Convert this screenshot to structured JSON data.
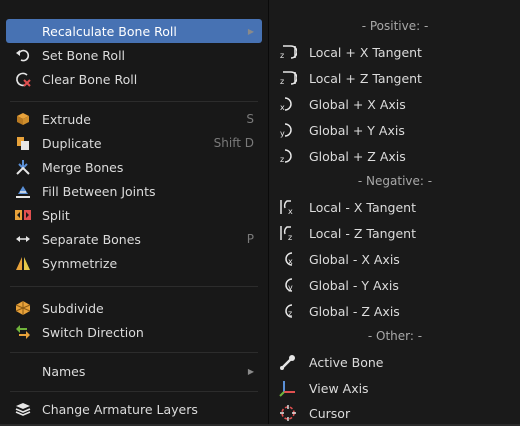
{
  "left_menu": {
    "items": [
      {
        "label": "Recalculate Bone Roll",
        "icon": "roll-icon",
        "shortcut": "",
        "submenu": true,
        "highlighted": true
      },
      {
        "label": "Set Bone Roll",
        "icon": "undo-curve-icon",
        "shortcut": ""
      },
      {
        "label": "Clear Bone Roll",
        "icon": "clear-roll-icon",
        "shortcut": ""
      },
      {
        "label": "Extrude",
        "icon": "extrude-icon",
        "shortcut": "S"
      },
      {
        "label": "Duplicate",
        "icon": "duplicate-icon",
        "shortcut": "Shift D"
      },
      {
        "label": "Merge Bones",
        "icon": "merge-icon",
        "shortcut": ""
      },
      {
        "label": "Fill Between Joints",
        "icon": "fill-icon",
        "shortcut": ""
      },
      {
        "label": "Split",
        "icon": "split-icon",
        "shortcut": ""
      },
      {
        "label": "Separate Bones",
        "icon": "separate-icon",
        "shortcut": "P"
      },
      {
        "label": "Symmetrize",
        "icon": "symmetrize-icon",
        "shortcut": ""
      },
      {
        "label": "Subdivide",
        "icon": "subdivide-icon",
        "shortcut": ""
      },
      {
        "label": "Switch Direction",
        "icon": "switch-direction-icon",
        "shortcut": ""
      },
      {
        "label": "Names",
        "icon": "",
        "shortcut": "",
        "submenu": true
      },
      {
        "label": "Change Armature Layers",
        "icon": "layers-icon",
        "shortcut": ""
      }
    ]
  },
  "right_menu": {
    "positive_header": "- Positive: -",
    "negative_header": "- Negative: -",
    "other_header": "- Other: -",
    "positive": [
      {
        "label": "Local + X Tangent",
        "icon": "local-x-tangent-icon"
      },
      {
        "label": "Local + Z Tangent",
        "icon": "local-z-tangent-icon"
      },
      {
        "label": "Global + X Axis",
        "icon": "global-x-axis-icon"
      },
      {
        "label": "Global + Y Axis",
        "icon": "global-y-axis-icon"
      },
      {
        "label": "Global + Z Axis",
        "icon": "global-z-axis-icon"
      }
    ],
    "negative": [
      {
        "label": "Local - X Tangent",
        "icon": "local-neg-x-tangent-icon"
      },
      {
        "label": "Local - Z Tangent",
        "icon": "local-neg-z-tangent-icon"
      },
      {
        "label": "Global - X Axis",
        "icon": "global-neg-x-axis-icon"
      },
      {
        "label": "Global - Y Axis",
        "icon": "global-neg-y-axis-icon"
      },
      {
        "label": "Global - Z Axis",
        "icon": "global-neg-z-axis-icon"
      }
    ],
    "other": [
      {
        "label": "Active Bone",
        "icon": "bone-icon"
      },
      {
        "label": "View Axis",
        "icon": "view-axis-icon"
      },
      {
        "label": "Cursor",
        "icon": "cursor-icon"
      }
    ]
  },
  "colors": {
    "highlight": "#4772b3",
    "menu_bg": "#181818",
    "text": "#dcdcdc",
    "red": "#e05050",
    "orange": "#e8a23a",
    "yellow": "#e6c84a",
    "green": "#6fb33b",
    "blue": "#5a8fd6"
  }
}
